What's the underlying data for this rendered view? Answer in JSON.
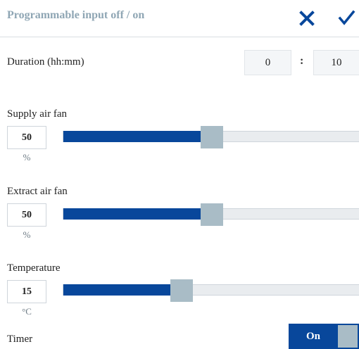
{
  "header": {
    "title": "Programmable input off / on",
    "cancel_icon": "close-icon",
    "confirm_icon": "check-icon",
    "accent": "#08479b"
  },
  "duration": {
    "label": "Duration (hh:mm)",
    "hours": "0",
    "separator": ":",
    "minutes": "10"
  },
  "supply_fan": {
    "label": "Supply air fan",
    "value": "50",
    "unit": "%",
    "level": 0.5
  },
  "extract_fan": {
    "label": "Extract air fan",
    "value": "50",
    "unit": "%",
    "level": 0.5
  },
  "temperature": {
    "label": "Temperature",
    "value": "15",
    "unit": "°C",
    "level": 0.4
  },
  "timer": {
    "label": "Timer",
    "state": "On"
  },
  "colors": {
    "slider_fill": "#08479b",
    "slider_thumb": "#a9bcc6",
    "track": "#e9ecef"
  }
}
